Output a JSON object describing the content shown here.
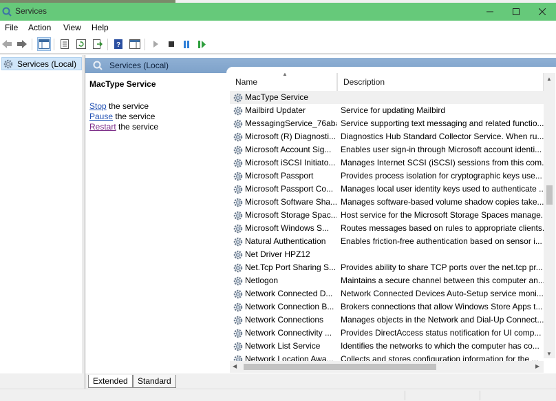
{
  "window": {
    "title": "Services"
  },
  "menu": [
    "File",
    "Action",
    "View",
    "Help"
  ],
  "tree": {
    "root_label": "Services (Local)"
  },
  "header": {
    "label": "Services (Local)"
  },
  "extended": {
    "service_name": "MacType Service",
    "stop_link": "Stop",
    "stop_suffix": " the service",
    "pause_link": "Pause",
    "pause_suffix": " the service",
    "restart_link": "Restart",
    "restart_suffix": " the service"
  },
  "columns": {
    "name": "Name",
    "description": "Description"
  },
  "services": [
    {
      "name": "MacType Service",
      "description": ""
    },
    {
      "name": "Mailbird Updater",
      "description": "Service for updating Mailbird"
    },
    {
      "name": "MessagingService_76aba",
      "description": "Service supporting text messaging and related functio..."
    },
    {
      "name": "Microsoft (R) Diagnosti...",
      "description": "Diagnostics Hub Standard Collector Service. When ru..."
    },
    {
      "name": "Microsoft Account Sig...",
      "description": "Enables user sign-in through Microsoft account identi..."
    },
    {
      "name": "Microsoft iSCSI Initiato...",
      "description": "Manages Internet SCSI (iSCSI) sessions from this com..."
    },
    {
      "name": "Microsoft Passport",
      "description": "Provides process isolation for cryptographic keys use..."
    },
    {
      "name": "Microsoft Passport Co...",
      "description": "Manages local user identity keys used to authenticate ..."
    },
    {
      "name": "Microsoft Software Sha...",
      "description": "Manages software-based volume shadow copies take..."
    },
    {
      "name": "Microsoft Storage Spac...",
      "description": "Host service for the Microsoft Storage Spaces manage..."
    },
    {
      "name": "Microsoft Windows S...",
      "description": "Routes messages based on rules to appropriate clients."
    },
    {
      "name": "Natural Authentication",
      "description": "Enables friction-free authentication based on sensor i..."
    },
    {
      "name": "Net Driver HPZ12",
      "description": ""
    },
    {
      "name": "Net.Tcp Port Sharing S...",
      "description": "Provides ability to share TCP ports over the net.tcp pr..."
    },
    {
      "name": "Netlogon",
      "description": "Maintains a secure channel between this computer an..."
    },
    {
      "name": "Network Connected D...",
      "description": "Network Connected Devices Auto-Setup service moni..."
    },
    {
      "name": "Network Connection B...",
      "description": "Brokers connections that allow Windows Store Apps t..."
    },
    {
      "name": "Network Connections",
      "description": "Manages objects in the Network and Dial-Up Connect..."
    },
    {
      "name": "Network Connectivity ...",
      "description": "Provides DirectAccess status notification for UI comp..."
    },
    {
      "name": "Network List Service",
      "description": "Identifies the networks to which the computer has co..."
    },
    {
      "name": "Network Location Awa...",
      "description": "Collects and stores configuration information for the ..."
    }
  ],
  "tabs": [
    "Extended",
    "Standard"
  ],
  "colors": {
    "titlebar": "#66c97a",
    "header_band": "#8fb0d4",
    "selection": "#cfe5f9"
  }
}
